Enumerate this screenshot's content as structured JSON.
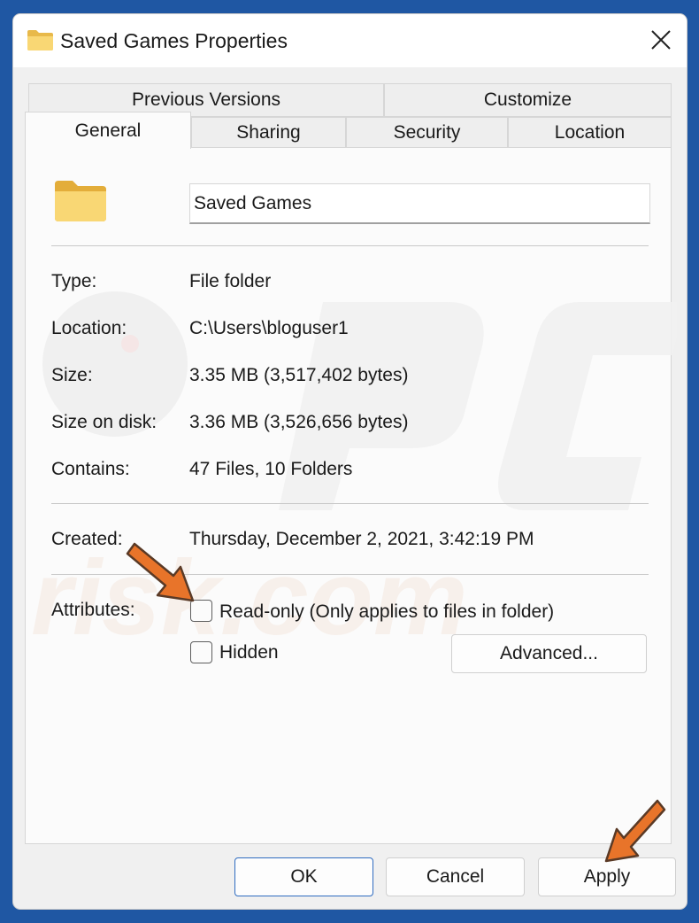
{
  "title": "Saved Games Properties",
  "tabs_row1": [
    "Previous Versions",
    "Customize"
  ],
  "tabs_row2": [
    "General",
    "Sharing",
    "Security",
    "Location"
  ],
  "folder_name": "Saved Games",
  "properties": [
    {
      "label": "Type:",
      "value": "File folder"
    },
    {
      "label": "Location:",
      "value": "C:\\Users\\bloguser1"
    },
    {
      "label": "Size:",
      "value": "3.35 MB (3,517,402 bytes)"
    },
    {
      "label": "Size on disk:",
      "value": "3.36 MB (3,526,656 bytes)"
    },
    {
      "label": "Contains:",
      "value": "47 Files, 10 Folders"
    }
  ],
  "created": {
    "label": "Created:",
    "value": "Thursday, December 2, 2021, 3:42:19 PM"
  },
  "attributes": {
    "label": "Attributes:",
    "readonly": {
      "label": "Read-only (Only applies to files in folder)",
      "checked": false
    },
    "hidden": {
      "label": "Hidden",
      "checked": false
    },
    "advanced_label": "Advanced..."
  },
  "buttons": {
    "ok": "OK",
    "cancel": "Cancel",
    "apply": "Apply"
  },
  "colors": {
    "accent": "#2f6cc0",
    "arrow": "#e8742a",
    "folder": "#f7d46a",
    "desktop": "#1f57a3"
  },
  "icons": {
    "title_icon": "folder-icon",
    "close": "close-icon",
    "folder": "folder-icon",
    "arrow": "arrow-annotation-icon"
  }
}
